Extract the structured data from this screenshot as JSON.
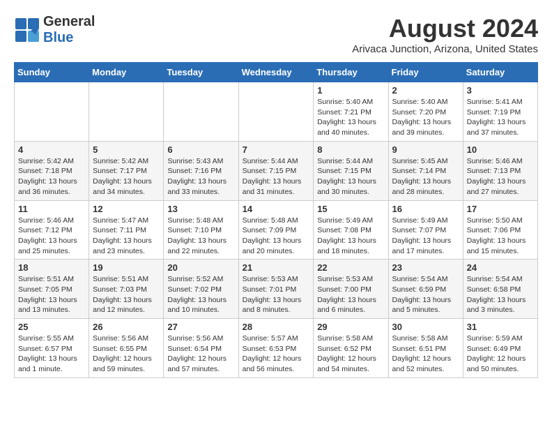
{
  "header": {
    "logo_general": "General",
    "logo_blue": "Blue",
    "title": "August 2024",
    "subtitle": "Arivaca Junction, Arizona, United States"
  },
  "days_of_week": [
    "Sunday",
    "Monday",
    "Tuesday",
    "Wednesday",
    "Thursday",
    "Friday",
    "Saturday"
  ],
  "weeks": [
    {
      "days": [
        {
          "number": "",
          "info": ""
        },
        {
          "number": "",
          "info": ""
        },
        {
          "number": "",
          "info": ""
        },
        {
          "number": "",
          "info": ""
        },
        {
          "number": "1",
          "info": "Sunrise: 5:40 AM\nSunset: 7:21 PM\nDaylight: 13 hours\nand 40 minutes."
        },
        {
          "number": "2",
          "info": "Sunrise: 5:40 AM\nSunset: 7:20 PM\nDaylight: 13 hours\nand 39 minutes."
        },
        {
          "number": "3",
          "info": "Sunrise: 5:41 AM\nSunset: 7:19 PM\nDaylight: 13 hours\nand 37 minutes."
        }
      ]
    },
    {
      "days": [
        {
          "number": "4",
          "info": "Sunrise: 5:42 AM\nSunset: 7:18 PM\nDaylight: 13 hours\nand 36 minutes."
        },
        {
          "number": "5",
          "info": "Sunrise: 5:42 AM\nSunset: 7:17 PM\nDaylight: 13 hours\nand 34 minutes."
        },
        {
          "number": "6",
          "info": "Sunrise: 5:43 AM\nSunset: 7:16 PM\nDaylight: 13 hours\nand 33 minutes."
        },
        {
          "number": "7",
          "info": "Sunrise: 5:44 AM\nSunset: 7:15 PM\nDaylight: 13 hours\nand 31 minutes."
        },
        {
          "number": "8",
          "info": "Sunrise: 5:44 AM\nSunset: 7:15 PM\nDaylight: 13 hours\nand 30 minutes."
        },
        {
          "number": "9",
          "info": "Sunrise: 5:45 AM\nSunset: 7:14 PM\nDaylight: 13 hours\nand 28 minutes."
        },
        {
          "number": "10",
          "info": "Sunrise: 5:46 AM\nSunset: 7:13 PM\nDaylight: 13 hours\nand 27 minutes."
        }
      ]
    },
    {
      "days": [
        {
          "number": "11",
          "info": "Sunrise: 5:46 AM\nSunset: 7:12 PM\nDaylight: 13 hours\nand 25 minutes."
        },
        {
          "number": "12",
          "info": "Sunrise: 5:47 AM\nSunset: 7:11 PM\nDaylight: 13 hours\nand 23 minutes."
        },
        {
          "number": "13",
          "info": "Sunrise: 5:48 AM\nSunset: 7:10 PM\nDaylight: 13 hours\nand 22 minutes."
        },
        {
          "number": "14",
          "info": "Sunrise: 5:48 AM\nSunset: 7:09 PM\nDaylight: 13 hours\nand 20 minutes."
        },
        {
          "number": "15",
          "info": "Sunrise: 5:49 AM\nSunset: 7:08 PM\nDaylight: 13 hours\nand 18 minutes."
        },
        {
          "number": "16",
          "info": "Sunrise: 5:49 AM\nSunset: 7:07 PM\nDaylight: 13 hours\nand 17 minutes."
        },
        {
          "number": "17",
          "info": "Sunrise: 5:50 AM\nSunset: 7:06 PM\nDaylight: 13 hours\nand 15 minutes."
        }
      ]
    },
    {
      "days": [
        {
          "number": "18",
          "info": "Sunrise: 5:51 AM\nSunset: 7:05 PM\nDaylight: 13 hours\nand 13 minutes."
        },
        {
          "number": "19",
          "info": "Sunrise: 5:51 AM\nSunset: 7:03 PM\nDaylight: 13 hours\nand 12 minutes."
        },
        {
          "number": "20",
          "info": "Sunrise: 5:52 AM\nSunset: 7:02 PM\nDaylight: 13 hours\nand 10 minutes."
        },
        {
          "number": "21",
          "info": "Sunrise: 5:53 AM\nSunset: 7:01 PM\nDaylight: 13 hours\nand 8 minutes."
        },
        {
          "number": "22",
          "info": "Sunrise: 5:53 AM\nSunset: 7:00 PM\nDaylight: 13 hours\nand 6 minutes."
        },
        {
          "number": "23",
          "info": "Sunrise: 5:54 AM\nSunset: 6:59 PM\nDaylight: 13 hours\nand 5 minutes."
        },
        {
          "number": "24",
          "info": "Sunrise: 5:54 AM\nSunset: 6:58 PM\nDaylight: 13 hours\nand 3 minutes."
        }
      ]
    },
    {
      "days": [
        {
          "number": "25",
          "info": "Sunrise: 5:55 AM\nSunset: 6:57 PM\nDaylight: 13 hours\nand 1 minute."
        },
        {
          "number": "26",
          "info": "Sunrise: 5:56 AM\nSunset: 6:55 PM\nDaylight: 12 hours\nand 59 minutes."
        },
        {
          "number": "27",
          "info": "Sunrise: 5:56 AM\nSunset: 6:54 PM\nDaylight: 12 hours\nand 57 minutes."
        },
        {
          "number": "28",
          "info": "Sunrise: 5:57 AM\nSunset: 6:53 PM\nDaylight: 12 hours\nand 56 minutes."
        },
        {
          "number": "29",
          "info": "Sunrise: 5:58 AM\nSunset: 6:52 PM\nDaylight: 12 hours\nand 54 minutes."
        },
        {
          "number": "30",
          "info": "Sunrise: 5:58 AM\nSunset: 6:51 PM\nDaylight: 12 hours\nand 52 minutes."
        },
        {
          "number": "31",
          "info": "Sunrise: 5:59 AM\nSunset: 6:49 PM\nDaylight: 12 hours\nand 50 minutes."
        }
      ]
    }
  ]
}
